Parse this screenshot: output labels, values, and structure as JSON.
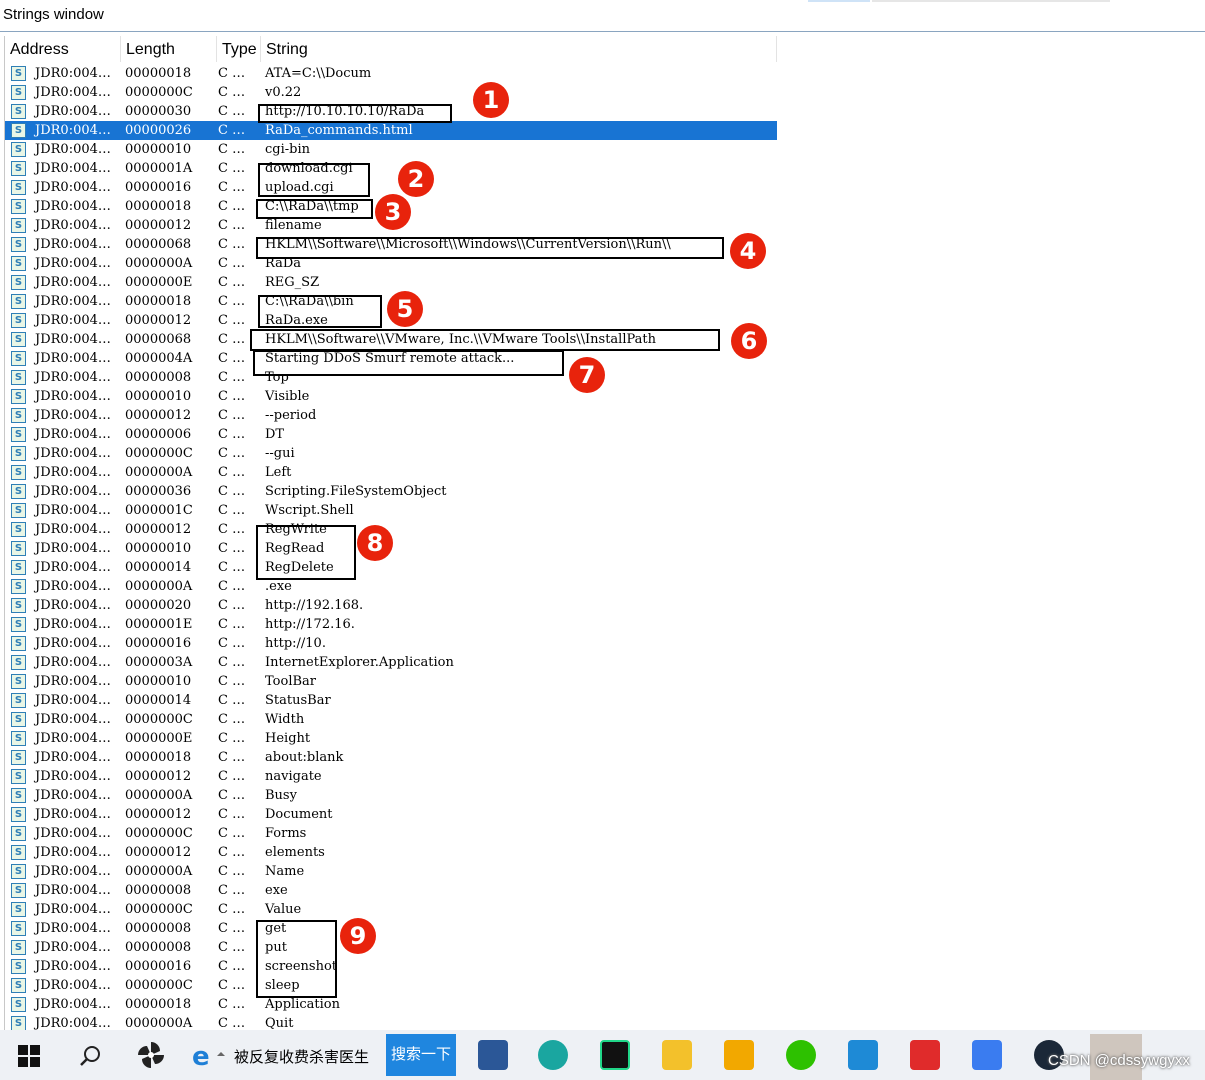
{
  "window": {
    "title": "Strings window"
  },
  "columns": [
    "Address",
    "Length",
    "Type",
    "String"
  ],
  "rows": [
    {
      "address": "JDR0:004…",
      "length": "00000018",
      "type": "C …",
      "string": "ATA=C:\\\\Docum"
    },
    {
      "address": "JDR0:004…",
      "length": "0000000C",
      "type": "C …",
      "string": "v0.22"
    },
    {
      "address": "JDR0:004…",
      "length": "00000030",
      "type": "C …",
      "string": "http://10.10.10.10/RaDa"
    },
    {
      "address": "JDR0:004…",
      "length": "00000026",
      "type": "C …",
      "string": "RaDa_commands.html",
      "selected": true
    },
    {
      "address": "JDR0:004…",
      "length": "00000010",
      "type": "C …",
      "string": "cgi-bin"
    },
    {
      "address": "JDR0:004…",
      "length": "0000001A",
      "type": "C …",
      "string": "download.cgi"
    },
    {
      "address": "JDR0:004…",
      "length": "00000016",
      "type": "C …",
      "string": "upload.cgi"
    },
    {
      "address": "JDR0:004…",
      "length": "00000018",
      "type": "C …",
      "string": "C:\\\\RaDa\\\\tmp"
    },
    {
      "address": "JDR0:004…",
      "length": "00000012",
      "type": "C …",
      "string": "filename"
    },
    {
      "address": "JDR0:004…",
      "length": "00000068",
      "type": "C …",
      "string": "HKLM\\\\Software\\\\Microsoft\\\\Windows\\\\CurrentVersion\\\\Run\\\\"
    },
    {
      "address": "JDR0:004…",
      "length": "0000000A",
      "type": "C …",
      "string": "RaDa"
    },
    {
      "address": "JDR0:004…",
      "length": "0000000E",
      "type": "C …",
      "string": "REG_SZ"
    },
    {
      "address": "JDR0:004…",
      "length": "00000018",
      "type": "C …",
      "string": "C:\\\\RaDa\\\\bin"
    },
    {
      "address": "JDR0:004…",
      "length": "00000012",
      "type": "C …",
      "string": "RaDa.exe"
    },
    {
      "address": "JDR0:004…",
      "length": "00000068",
      "type": "C …",
      "string": "HKLM\\\\Software\\\\VMware, Inc.\\\\VMware Tools\\\\InstallPath"
    },
    {
      "address": "JDR0:004…",
      "length": "0000004A",
      "type": "C …",
      "string": "Starting DDoS Smurf remote attack..."
    },
    {
      "address": "JDR0:004…",
      "length": "00000008",
      "type": "C …",
      "string": "Top"
    },
    {
      "address": "JDR0:004…",
      "length": "00000010",
      "type": "C …",
      "string": "Visible"
    },
    {
      "address": "JDR0:004…",
      "length": "00000012",
      "type": "C …",
      "string": "--period"
    },
    {
      "address": "JDR0:004…",
      "length": "00000006",
      "type": "C …",
      "string": "DT"
    },
    {
      "address": "JDR0:004…",
      "length": "0000000C",
      "type": "C …",
      "string": "--gui"
    },
    {
      "address": "JDR0:004…",
      "length": "0000000A",
      "type": "C …",
      "string": "Left"
    },
    {
      "address": "JDR0:004…",
      "length": "00000036",
      "type": "C …",
      "string": "Scripting.FileSystemObject"
    },
    {
      "address": "JDR0:004…",
      "length": "0000001C",
      "type": "C …",
      "string": "Wscript.Shell"
    },
    {
      "address": "JDR0:004…",
      "length": "00000012",
      "type": "C …",
      "string": "RegWrite"
    },
    {
      "address": "JDR0:004…",
      "length": "00000010",
      "type": "C …",
      "string": "RegRead"
    },
    {
      "address": "JDR0:004…",
      "length": "00000014",
      "type": "C …",
      "string": "RegDelete"
    },
    {
      "address": "JDR0:004…",
      "length": "0000000A",
      "type": "C …",
      "string": ".exe"
    },
    {
      "address": "JDR0:004…",
      "length": "00000020",
      "type": "C …",
      "string": "http://192.168."
    },
    {
      "address": "JDR0:004…",
      "length": "0000001E",
      "type": "C …",
      "string": "http://172.16."
    },
    {
      "address": "JDR0:004…",
      "length": "00000016",
      "type": "C …",
      "string": "http://10."
    },
    {
      "address": "JDR0:004…",
      "length": "0000003A",
      "type": "C …",
      "string": "InternetExplorer.Application"
    },
    {
      "address": "JDR0:004…",
      "length": "00000010",
      "type": "C …",
      "string": "ToolBar"
    },
    {
      "address": "JDR0:004…",
      "length": "00000014",
      "type": "C …",
      "string": "StatusBar"
    },
    {
      "address": "JDR0:004…",
      "length": "0000000C",
      "type": "C …",
      "string": "Width"
    },
    {
      "address": "JDR0:004…",
      "length": "0000000E",
      "type": "C …",
      "string": "Height"
    },
    {
      "address": "JDR0:004…",
      "length": "00000018",
      "type": "C …",
      "string": "about:blank"
    },
    {
      "address": "JDR0:004…",
      "length": "00000012",
      "type": "C …",
      "string": "navigate"
    },
    {
      "address": "JDR0:004…",
      "length": "0000000A",
      "type": "C …",
      "string": "Busy"
    },
    {
      "address": "JDR0:004…",
      "length": "00000012",
      "type": "C …",
      "string": "Document"
    },
    {
      "address": "JDR0:004…",
      "length": "0000000C",
      "type": "C …",
      "string": "Forms"
    },
    {
      "address": "JDR0:004…",
      "length": "00000012",
      "type": "C …",
      "string": "elements"
    },
    {
      "address": "JDR0:004…",
      "length": "0000000A",
      "type": "C …",
      "string": "Name"
    },
    {
      "address": "JDR0:004…",
      "length": "00000008",
      "type": "C …",
      "string": "exe"
    },
    {
      "address": "JDR0:004…",
      "length": "0000000C",
      "type": "C …",
      "string": "Value"
    },
    {
      "address": "JDR0:004…",
      "length": "00000008",
      "type": "C …",
      "string": "get"
    },
    {
      "address": "JDR0:004…",
      "length": "00000008",
      "type": "C …",
      "string": "put"
    },
    {
      "address": "JDR0:004…",
      "length": "00000016",
      "type": "C …",
      "string": "screenshot"
    },
    {
      "address": "JDR0:004…",
      "length": "0000000C",
      "type": "C …",
      "string": "sleep"
    },
    {
      "address": "JDR0:004…",
      "length": "00000018",
      "type": "C …",
      "string": "Application"
    },
    {
      "address": "JDR0:004…",
      "length": "0000000A",
      "type": "C …",
      "string": "Quit"
    }
  ],
  "row_icon": "S",
  "annotations": [
    "1",
    "2",
    "3",
    "4",
    "5",
    "6",
    "7",
    "8",
    "9"
  ],
  "annotation_color": "#e8230c",
  "selection_color": "#1874d3",
  "taskbar": {
    "edge_tab": "被反复收费杀害医生",
    "search_button": "搜索一下",
    "watermark": "CSDN @cdssywgyxx",
    "apps": [
      "windows-start-icon",
      "search-icon",
      "pinwheel-icon",
      "ie-icon",
      "word-icon",
      "edge-icon",
      "pycharm-icon",
      "file-explorer-icon",
      "puzzle-icon",
      "wechat-icon",
      "vscode-icon",
      "wps-icon",
      "feishu-icon",
      "steam-icon",
      "avatar-icon"
    ]
  }
}
